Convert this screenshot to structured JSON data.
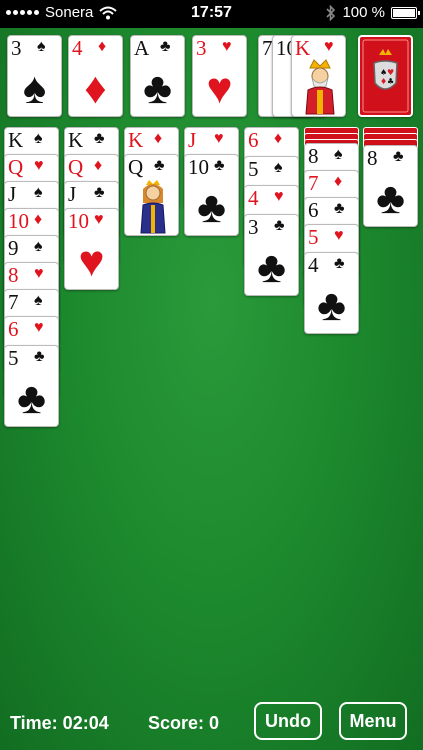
{
  "status_bar": {
    "carrier": "Sonera",
    "time": "17:57",
    "battery": "100 %",
    "icons": [
      "signal-icon",
      "wifi-icon",
      "bluetooth-icon",
      "battery-icon"
    ]
  },
  "colors": {
    "felt": "#1d8a2e",
    "red_suit": "#e0141e",
    "card_back": "#d0101a"
  },
  "foundations": [
    {
      "rank": "3",
      "suit": "♠",
      "color": "black"
    },
    {
      "rank": "4",
      "suit": "♦",
      "color": "red"
    },
    {
      "rank": "A",
      "suit": "♣",
      "color": "black"
    },
    {
      "rank": "3",
      "suit": "♥",
      "color": "red"
    }
  ],
  "waste": [
    {
      "rank": "7",
      "suit": "",
      "color": "black"
    },
    {
      "rank": "10",
      "suit": "",
      "color": "black"
    },
    {
      "rank": "K",
      "suit": "♥",
      "color": "red"
    }
  ],
  "tableau": [
    {
      "backs": 0,
      "cards": [
        {
          "rank": "K",
          "suit": "♠",
          "color": "black"
        },
        {
          "rank": "Q",
          "suit": "♥",
          "color": "red"
        },
        {
          "rank": "J",
          "suit": "♠",
          "color": "black"
        },
        {
          "rank": "10",
          "suit": "♦",
          "color": "red"
        },
        {
          "rank": "9",
          "suit": "♠",
          "color": "black"
        },
        {
          "rank": "8",
          "suit": "♥",
          "color": "red"
        },
        {
          "rank": "7",
          "suit": "♠",
          "color": "black"
        },
        {
          "rank": "6",
          "suit": "♥",
          "color": "red"
        },
        {
          "rank": "5",
          "suit": "♣",
          "color": "black"
        }
      ]
    },
    {
      "backs": 0,
      "cards": [
        {
          "rank": "K",
          "suit": "♣",
          "color": "black"
        },
        {
          "rank": "Q",
          "suit": "♦",
          "color": "red"
        },
        {
          "rank": "J",
          "suit": "♣",
          "color": "black"
        },
        {
          "rank": "10",
          "suit": "♥",
          "color": "red"
        }
      ]
    },
    {
      "backs": 0,
      "cards": [
        {
          "rank": "K",
          "suit": "♦",
          "color": "red"
        },
        {
          "rank": "Q",
          "suit": "♣",
          "color": "black"
        }
      ]
    },
    {
      "backs": 0,
      "cards": [
        {
          "rank": "J",
          "suit": "♥",
          "color": "red"
        },
        {
          "rank": "10",
          "suit": "♣",
          "color": "black"
        }
      ]
    },
    {
      "backs": 0,
      "cards": [
        {
          "rank": "6",
          "suit": "♦",
          "color": "red"
        },
        {
          "rank": "5",
          "suit": "♠",
          "color": "black"
        },
        {
          "rank": "4",
          "suit": "♥",
          "color": "red"
        },
        {
          "rank": "3",
          "suit": "♣",
          "color": "black"
        }
      ]
    },
    {
      "backs": 3,
      "cards": [
        {
          "rank": "8",
          "suit": "♠",
          "color": "black"
        },
        {
          "rank": "7",
          "suit": "♦",
          "color": "red"
        },
        {
          "rank": "6",
          "suit": "♣",
          "color": "black"
        },
        {
          "rank": "5",
          "suit": "♥",
          "color": "red"
        },
        {
          "rank": "4",
          "suit": "♣",
          "color": "black"
        }
      ]
    },
    {
      "backs": 3,
      "cards": [
        {
          "rank": "8",
          "suit": "♣",
          "color": "black"
        }
      ]
    }
  ],
  "bottom_bar": {
    "time_label": "Time: 02:04",
    "score_label": "Score: 0",
    "undo_label": "Undo",
    "menu_label": "Menu"
  }
}
